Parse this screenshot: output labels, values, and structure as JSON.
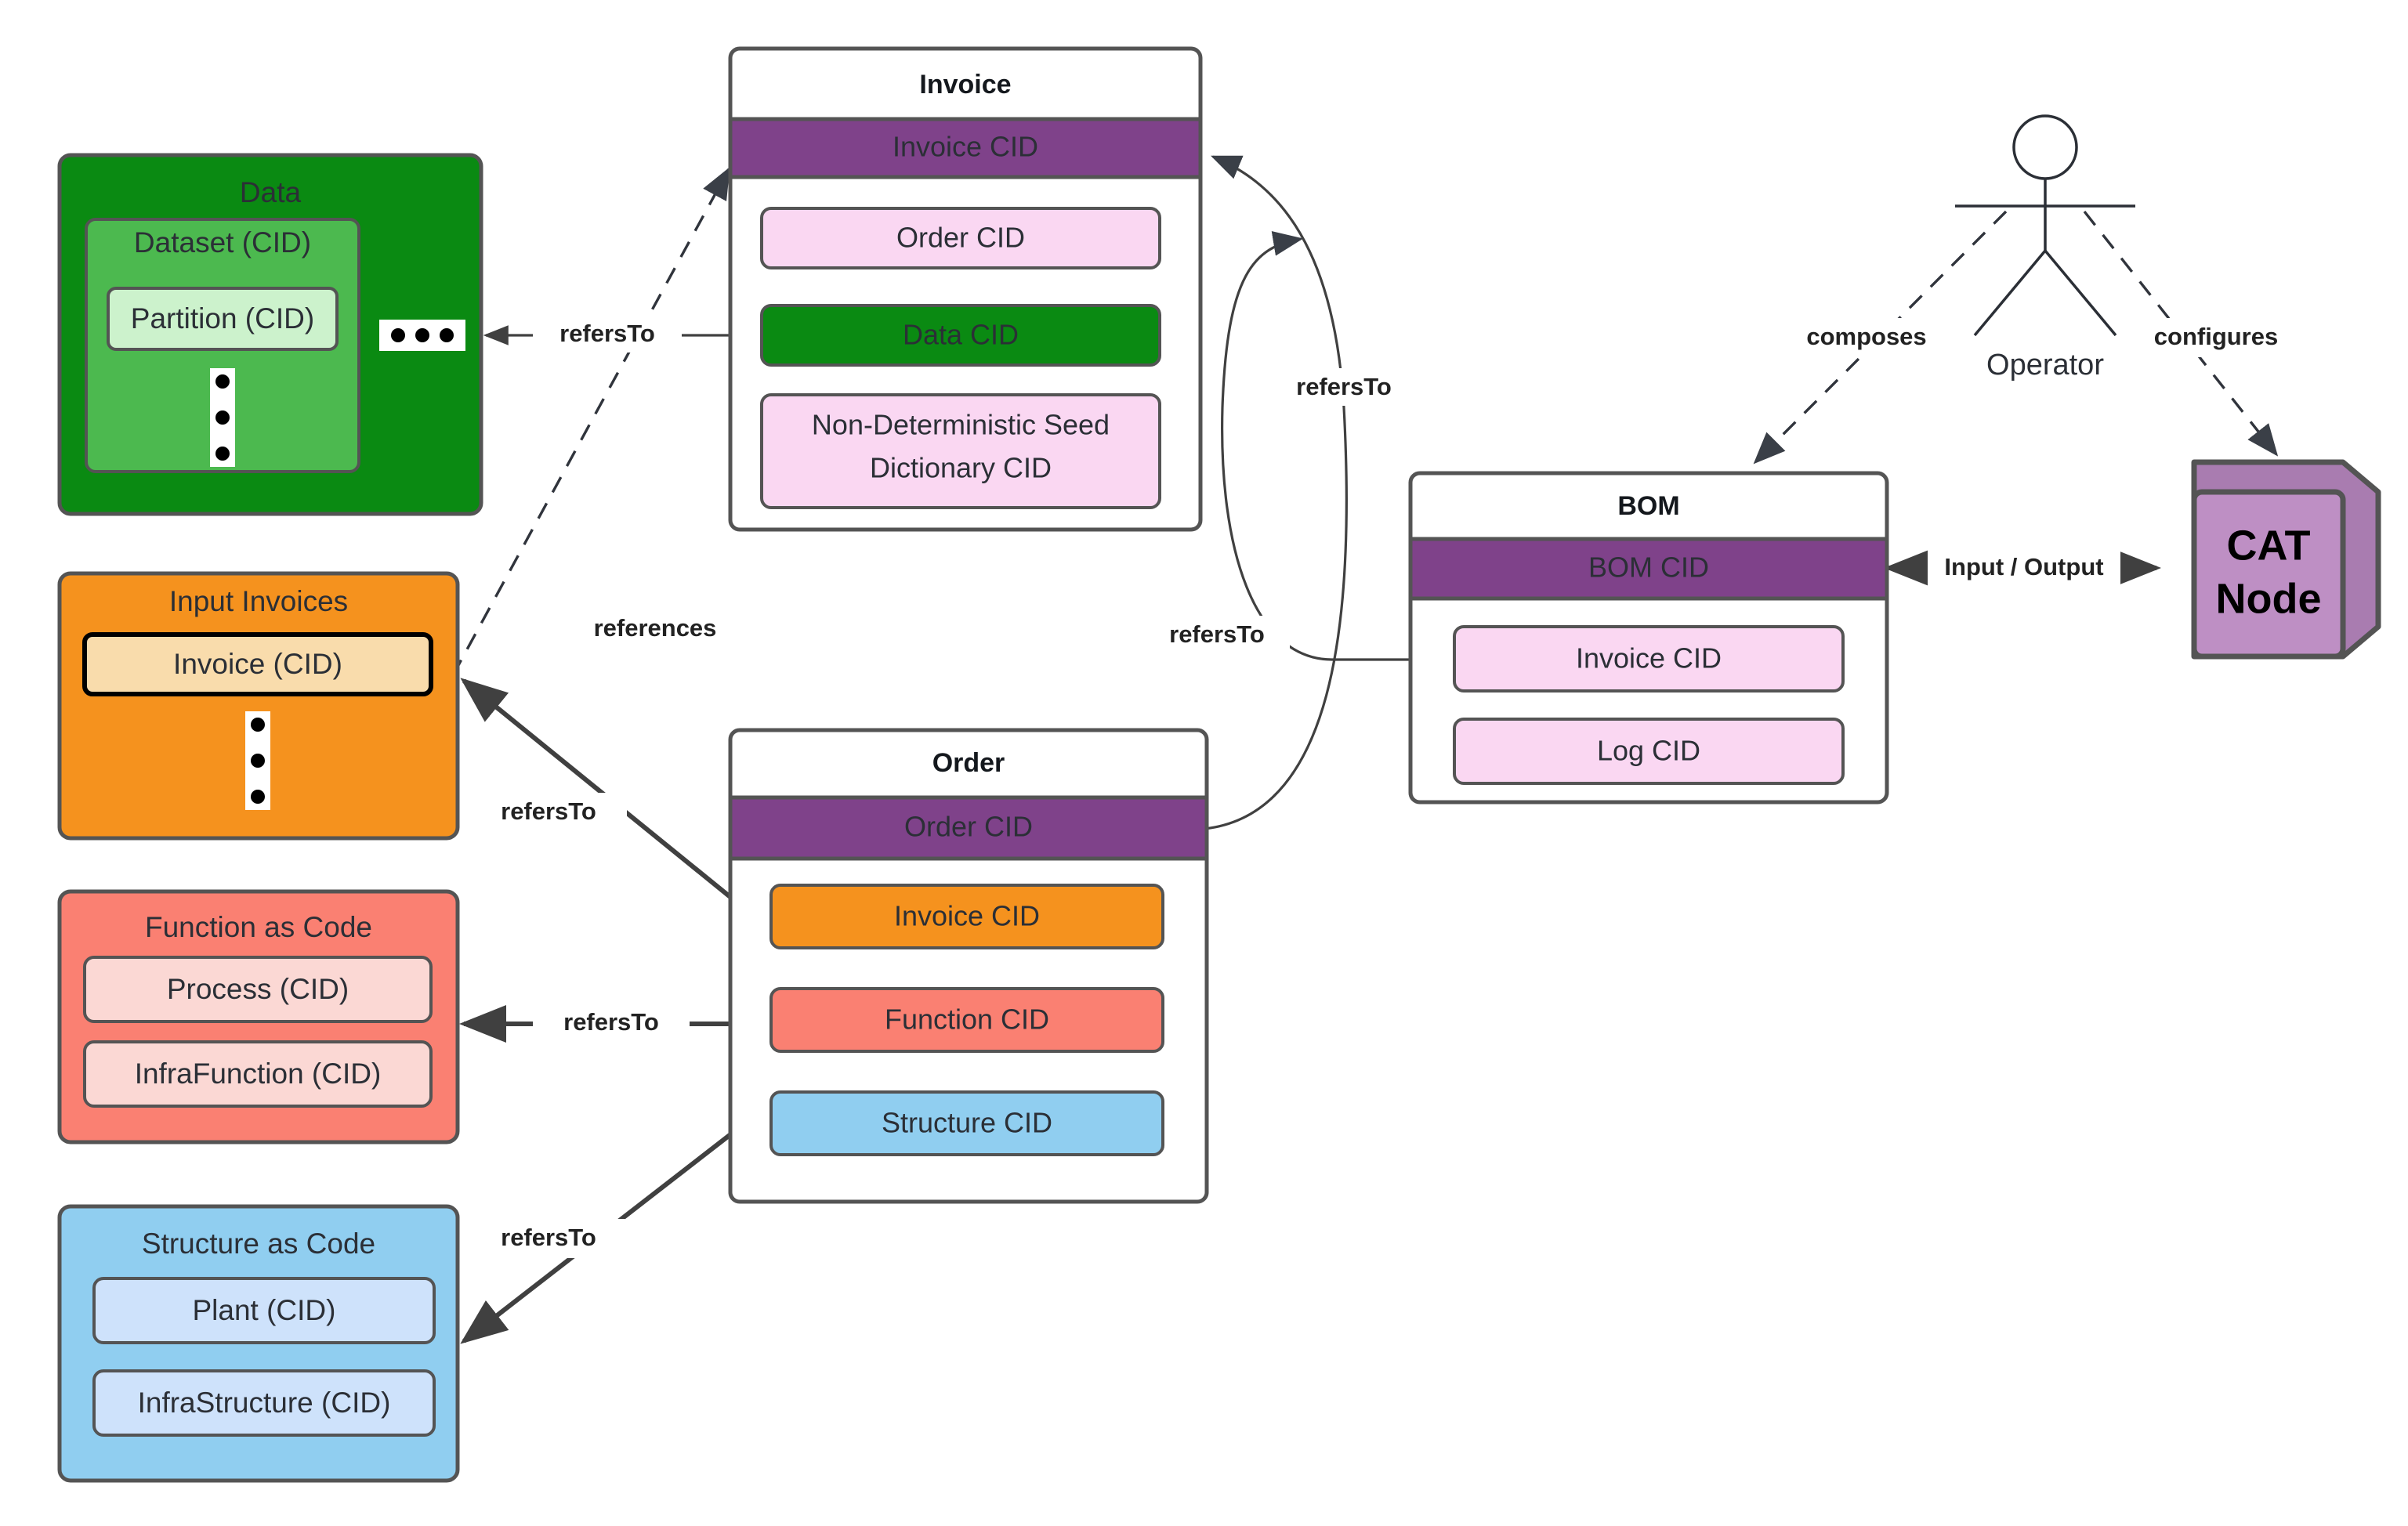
{
  "diagram": {
    "title": "CAT Node content-addressed artifact relationship diagram",
    "colors": {
      "purple_header": "#7F428A",
      "green_dark": "#0A8A12",
      "green_mid": "#4CB94F",
      "green_light": "#CCF2CC",
      "pink_light": "#FAD7F2",
      "orange": "#F5921E",
      "orange_light": "#F9DCAC",
      "salmon": "#FA8072",
      "salmon_light": "#FBD8D4",
      "blue": "#90CEF0",
      "blue_light": "#CEE2FB",
      "cat_purple": "#BE8FC4",
      "border_gray": "#545454",
      "edge_gray": "#404040"
    },
    "groups": [
      {
        "id": "data",
        "label": "Data",
        "children": [
          {
            "id": "dataset",
            "label": "Dataset (CID)",
            "children": [
              {
                "id": "partition",
                "label": "Partition (CID)"
              }
            ],
            "ellipsis": "vertical"
          }
        ],
        "ellipsis": "horizontal"
      },
      {
        "id": "input-invoices",
        "label": "Input Invoices",
        "children": [
          {
            "id": "invoice-cid-item",
            "label": "Invoice (CID)"
          }
        ],
        "ellipsis": "vertical"
      },
      {
        "id": "function-as-code",
        "label": "Function as Code",
        "children": [
          {
            "id": "process",
            "label": "Process (CID)"
          },
          {
            "id": "infrafunction",
            "label": "InfraFunction (CID)"
          }
        ]
      },
      {
        "id": "structure-as-code",
        "label": "Structure as Code",
        "children": [
          {
            "id": "plant",
            "label": "Plant (CID)"
          },
          {
            "id": "infrastructure",
            "label": "InfraStructure (CID)"
          }
        ]
      }
    ],
    "cards": [
      {
        "id": "invoice",
        "title": "Invoice",
        "header_row": "Invoice CID",
        "rows": [
          {
            "id": "invoice-order-cid",
            "label": "Order CID"
          },
          {
            "id": "invoice-data-cid",
            "label": "Data CID"
          },
          {
            "id": "invoice-nds-cid",
            "label": "Non-Deterministic Seed Dictionary CID"
          }
        ]
      },
      {
        "id": "order",
        "title": "Order",
        "header_row": "Order CID",
        "rows": [
          {
            "id": "order-invoice-cid",
            "label": "Invoice CID"
          },
          {
            "id": "order-function-cid",
            "label": "Function CID"
          },
          {
            "id": "order-structure-cid",
            "label": "Structure CID"
          }
        ]
      },
      {
        "id": "bom",
        "title": "BOM",
        "header_row": "BOM CID",
        "rows": [
          {
            "id": "bom-invoice-cid",
            "label": "Invoice CID"
          },
          {
            "id": "bom-log-cid",
            "label": "Log CID"
          }
        ]
      }
    ],
    "actor": {
      "id": "operator",
      "label": "Operator"
    },
    "cat_node": {
      "id": "cat-node",
      "line1": "CAT",
      "line2": "Node"
    },
    "edges": [
      {
        "id": "data-cid-to-data",
        "label": "refersTo"
      },
      {
        "id": "invoice-to-input-invoices",
        "label": "references"
      },
      {
        "id": "order-cid-to-invoice-cid",
        "label": "refersTo"
      },
      {
        "id": "bom-invoice-to-order-cid",
        "label": "refersTo"
      },
      {
        "id": "order-to-input-invoices",
        "label": "refersTo"
      },
      {
        "id": "function-cid-to-faac",
        "label": "refersTo"
      },
      {
        "id": "structure-cid-to-saac",
        "label": "refersTo"
      },
      {
        "id": "operator-composes-bom",
        "label": "composes"
      },
      {
        "id": "operator-configures-cat",
        "label": "configures"
      },
      {
        "id": "bom-cat-io",
        "label": "Input / Output"
      }
    ]
  }
}
